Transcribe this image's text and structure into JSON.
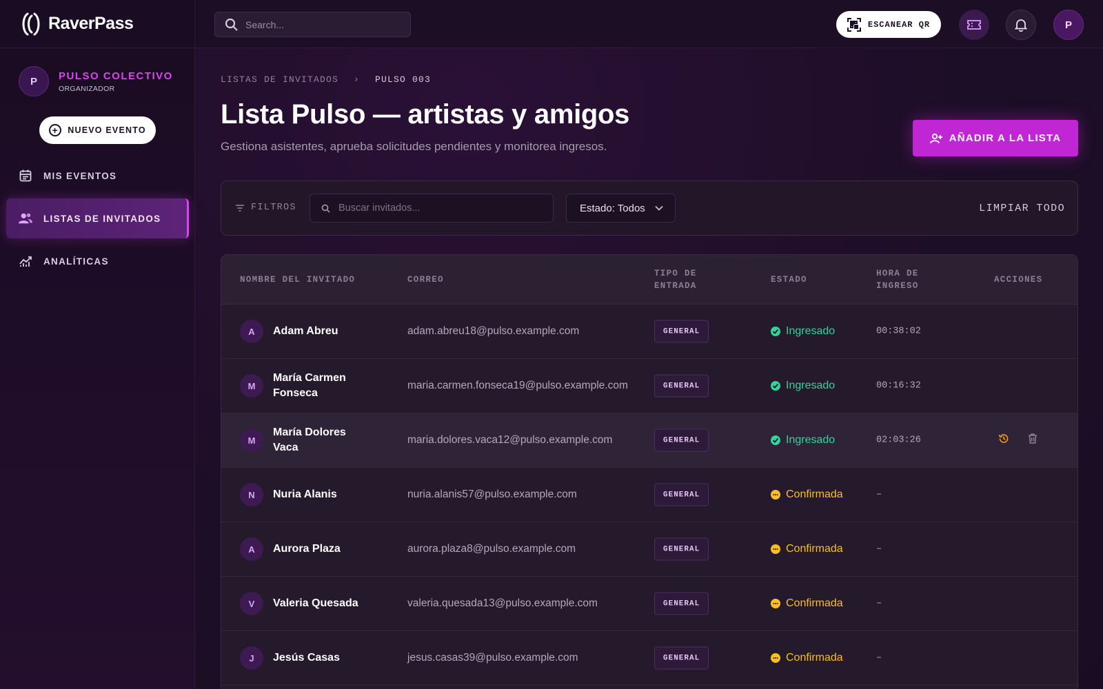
{
  "brand": {
    "name": "RaverPass"
  },
  "topbar": {
    "search_placeholder": "Search...",
    "scan_label": "ESCANEAR QR",
    "user_initial": "P"
  },
  "sidebar": {
    "org": {
      "initial": "P",
      "name": "PULSO COLECTIVO",
      "role": "ORGANIZADOR"
    },
    "new_event_label": "NUEVO EVENTO",
    "items": [
      {
        "label": "MIS EVENTOS",
        "icon": "calendar-icon",
        "active": false
      },
      {
        "label": "LISTAS DE INVITADOS",
        "icon": "users-icon",
        "active": true
      },
      {
        "label": "ANALÍTICAS",
        "icon": "chart-icon",
        "active": false
      }
    ]
  },
  "main": {
    "breadcrumb": [
      "LISTAS DE INVITADOS",
      "PULSO 003"
    ],
    "title": "Lista Pulso — artistas y amigos",
    "subtitle": "Gestiona asistentes, aprueba solicitudes pendientes y monitorea ingresos.",
    "add_button_label": "AÑADIR A LA LISTA",
    "filters": {
      "label": "FILTROS",
      "search_placeholder": "Buscar invitados...",
      "status_select": "Estado: Todos",
      "clear_label": "LIMPIAR TODO"
    },
    "table": {
      "headers": [
        "NOMBRE DEL INVITADO",
        "CORREO",
        "TIPO DE ENTRADA",
        "ESTADO",
        "HORA DE INGRESO",
        "ACCIONES"
      ],
      "rows": [
        {
          "initial": "A",
          "name": "Adam Abreu",
          "email": "adam.abreu18@pulso.example.com",
          "ticket": "GENERAL",
          "status": "Ingresado",
          "time": "00:38:02"
        },
        {
          "initial": "M",
          "name": "María Carmen Fonseca",
          "email": "maria.carmen.fonseca19@pulso.example.com",
          "ticket": "GENERAL",
          "status": "Ingresado",
          "time": "00:16:32"
        },
        {
          "initial": "M",
          "name": "María Dolores Vaca",
          "email": "maria.dolores.vaca12@pulso.example.com",
          "ticket": "GENERAL",
          "status": "Ingresado",
          "time": "02:03:26"
        },
        {
          "initial": "N",
          "name": "Nuria Alanis",
          "email": "nuria.alanis57@pulso.example.com",
          "ticket": "GENERAL",
          "status": "Confirmada",
          "time": "–"
        },
        {
          "initial": "A",
          "name": "Aurora Plaza",
          "email": "aurora.plaza8@pulso.example.com",
          "ticket": "GENERAL",
          "status": "Confirmada",
          "time": "–"
        },
        {
          "initial": "V",
          "name": "Valeria Quesada",
          "email": "valeria.quesada13@pulso.example.com",
          "ticket": "GENERAL",
          "status": "Confirmada",
          "time": "–"
        },
        {
          "initial": "J",
          "name": "Jesús Casas",
          "email": "jesus.casas39@pulso.example.com",
          "ticket": "GENERAL",
          "status": "Confirmada",
          "time": "–"
        }
      ]
    }
  },
  "colors": {
    "accent": "#c026d3",
    "accent_text": "#d946ef",
    "status_ingresado": "#34d399",
    "status_confirmada": "#fbbf24"
  }
}
